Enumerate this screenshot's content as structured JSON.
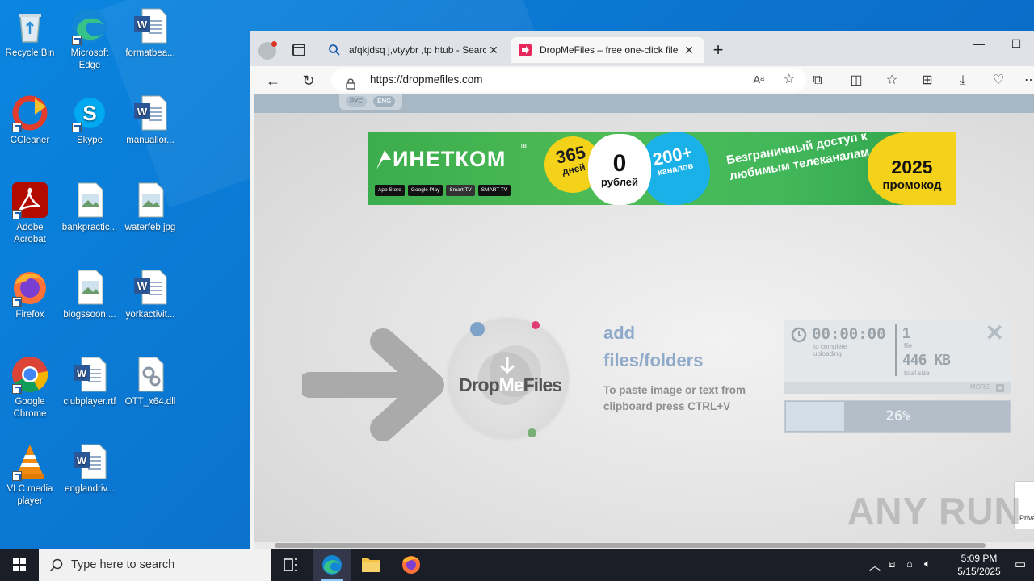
{
  "desktop": {
    "icons": [
      {
        "label": "Recycle Bin"
      },
      {
        "label": "Microsoft Edge"
      },
      {
        "label": "formatbea..."
      },
      {
        "label": "CCleaner"
      },
      {
        "label": "Skype"
      },
      {
        "label": "manuallor..."
      },
      {
        "label": "Adobe Acrobat"
      },
      {
        "label": "bankpractic..."
      },
      {
        "label": "waterfeb.jpg"
      },
      {
        "label": "Firefox"
      },
      {
        "label": "blogssoon...."
      },
      {
        "label": "yorkactivit..."
      },
      {
        "label": "Google Chrome"
      },
      {
        "label": "clubplayer.rtf"
      },
      {
        "label": "OTT_x64.dll"
      },
      {
        "label": "VLC media player"
      },
      {
        "label": "englandriv..."
      }
    ]
  },
  "browser": {
    "tabs": [
      {
        "title": "afqkjdsq j,vtyybr ,tp htub - Search",
        "icon": "search-icon"
      },
      {
        "title": "DropMeFiles – free one-click file",
        "icon": "dropmefiles-icon"
      }
    ],
    "address": "https://dropmefiles.com",
    "read_aloud_label": "Aᵃ"
  },
  "page": {
    "languages": [
      "РУС",
      "ENG"
    ],
    "banner": {
      "brand": "ИНЕТКОМ",
      "brand_suffix": "тв",
      "stores": [
        "App Store",
        "Google Play",
        "Smart TV",
        "SMART TV"
      ],
      "days_num": "365",
      "days_label": "дней",
      "price_num": "0",
      "price_label": "рублей",
      "channels_num": "200+",
      "channels_label": "каналов",
      "slogan": "Безграничный доступ к любимым телеканалам",
      "promo_year": "2025",
      "promo_label": "промокод"
    },
    "logo": {
      "part1": "Drop",
      "part2": "Me",
      "part3": "Files"
    },
    "add_title": "add files/folders",
    "paste_hint": "To paste image or text from clipboard press CTRL+V",
    "upload": {
      "time": "00:00:00",
      "time_label": "to complete uploading",
      "file_count": "1",
      "file_label": "file",
      "total_size": "446 KB",
      "total_size_label": "total size",
      "more_label": "MORE",
      "progress_text": "26%",
      "progress_fraction": 0.26
    },
    "privacy_label": "Priva",
    "watermark": "ANY RUN"
  },
  "taskbar": {
    "search_placeholder": "Type here to search",
    "time": "5:09 PM",
    "date": "5/15/2025"
  },
  "colors": {
    "desktop": "#0a78d4",
    "accent_blue": "#8faacb",
    "banner_green": "#3cad4d",
    "banner_yellow": "#f4d21a"
  }
}
